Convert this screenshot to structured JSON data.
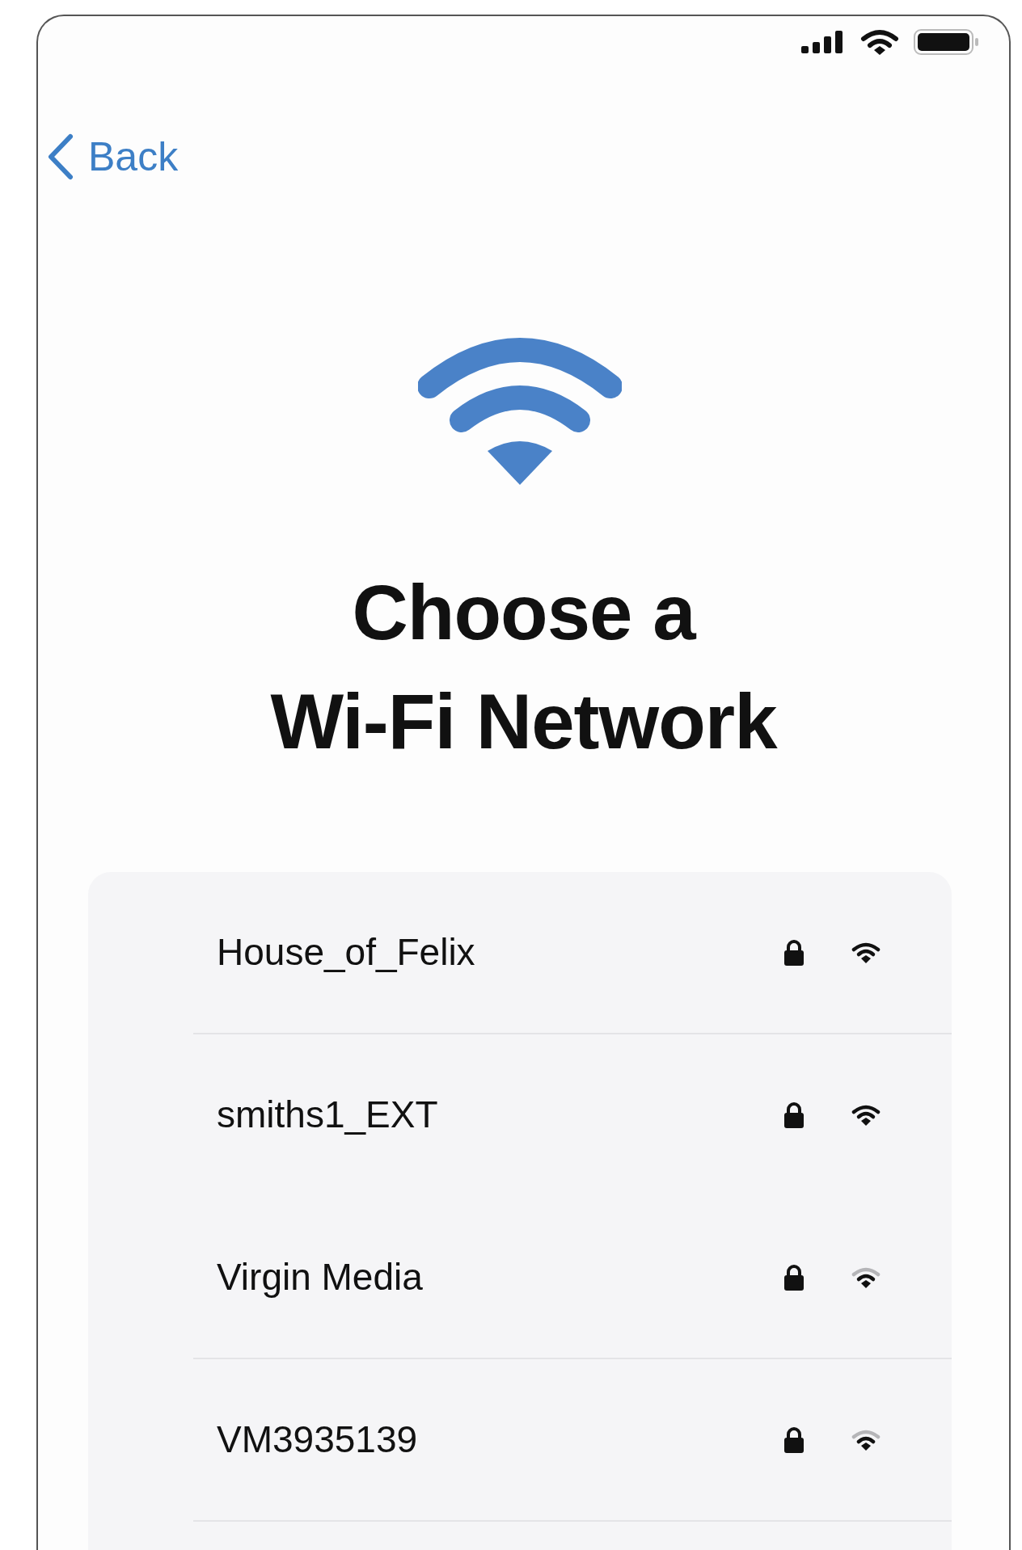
{
  "nav": {
    "back": "Back"
  },
  "title": [
    "Choose a",
    "Wi-Fi Network"
  ],
  "networks": [
    {
      "name": "House_of_Felix",
      "secured": true,
      "strong_signal": true,
      "divider_below": true
    },
    {
      "name": "smiths1_EXT",
      "secured": true,
      "strong_signal": true,
      "divider_below": false
    },
    {
      "name": "Virgin Media",
      "secured": true,
      "strong_signal": false,
      "divider_below": true
    },
    {
      "name": "VM3935139",
      "secured": true,
      "strong_signal": false,
      "divider_below": true
    }
  ]
}
